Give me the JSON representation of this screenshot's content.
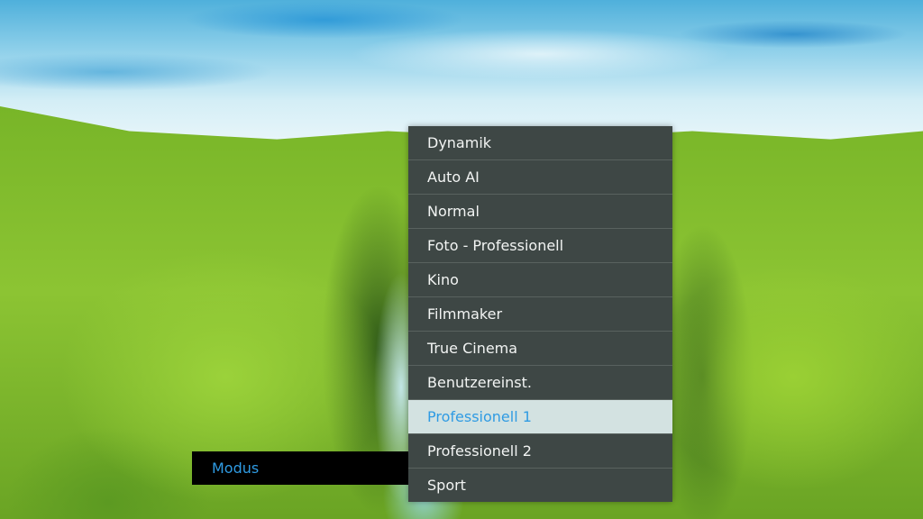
{
  "mode_setting": {
    "label": "Modus"
  },
  "mode_menu": {
    "selected_index": 8,
    "items": [
      {
        "label": "Dynamik"
      },
      {
        "label": "Auto AI"
      },
      {
        "label": "Normal"
      },
      {
        "label": "Foto - Professionell"
      },
      {
        "label": "Kino"
      },
      {
        "label": "Filmmaker"
      },
      {
        "label": "True Cinema"
      },
      {
        "label": "Benutzereinst."
      },
      {
        "label": "Professionell 1"
      },
      {
        "label": "Professionell 2"
      },
      {
        "label": "Sport"
      }
    ]
  },
  "colors": {
    "menu_background": "#3e4745",
    "menu_text": "#f2f4f3",
    "highlight_background": "#d3e2e1",
    "accent": "#2f9be3",
    "label_bar_background": "#000000"
  }
}
